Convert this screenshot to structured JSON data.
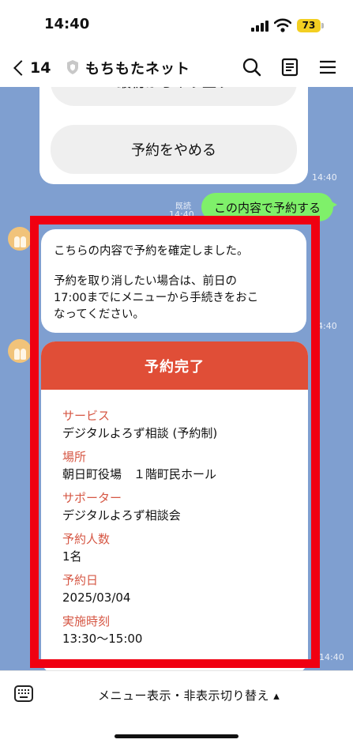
{
  "status_bar": {
    "time": "14:40",
    "battery": "73"
  },
  "header": {
    "back_count": "14",
    "title": "もちもたネット"
  },
  "chat": {
    "options": [
      "最初からやり直す",
      "予約をやめる"
    ],
    "options_time": "14:40",
    "read_label": "既読",
    "user_message": "この内容で予約する",
    "user_message_time": "14:40",
    "bot_message_line1": "こちらの内容で予約を確定しました。",
    "bot_message_line2": "予約を取り消したい場合は、前日の",
    "bot_message_line3": "17:00までにメニューから手続きをおこ",
    "bot_message_line4": "なってください。",
    "bot_message_time": "14:40",
    "card_time": "14:40",
    "confirmation": {
      "title": "予約完了",
      "fields": [
        {
          "label": "サービス",
          "value": "デジタルよろず相談 (予約制)"
        },
        {
          "label": "場所",
          "value": "朝日町役場　１階町民ホール"
        },
        {
          "label": "サポーター",
          "value": "デジタルよろず相談会"
        },
        {
          "label": "予約人数",
          "value": "1名"
        },
        {
          "label": "予約日",
          "value": "2025/03/04"
        },
        {
          "label": "実施時刻",
          "value": "13:30～15:00"
        }
      ]
    }
  },
  "bottom_bar": {
    "menu_toggle_label": "メニュー表示・非表示切り替え ▴"
  },
  "colors": {
    "accent": "#e04e37",
    "chat_bg": "#7f9fd0",
    "user_bubble": "#7ff06a",
    "highlight": "#f00011"
  }
}
